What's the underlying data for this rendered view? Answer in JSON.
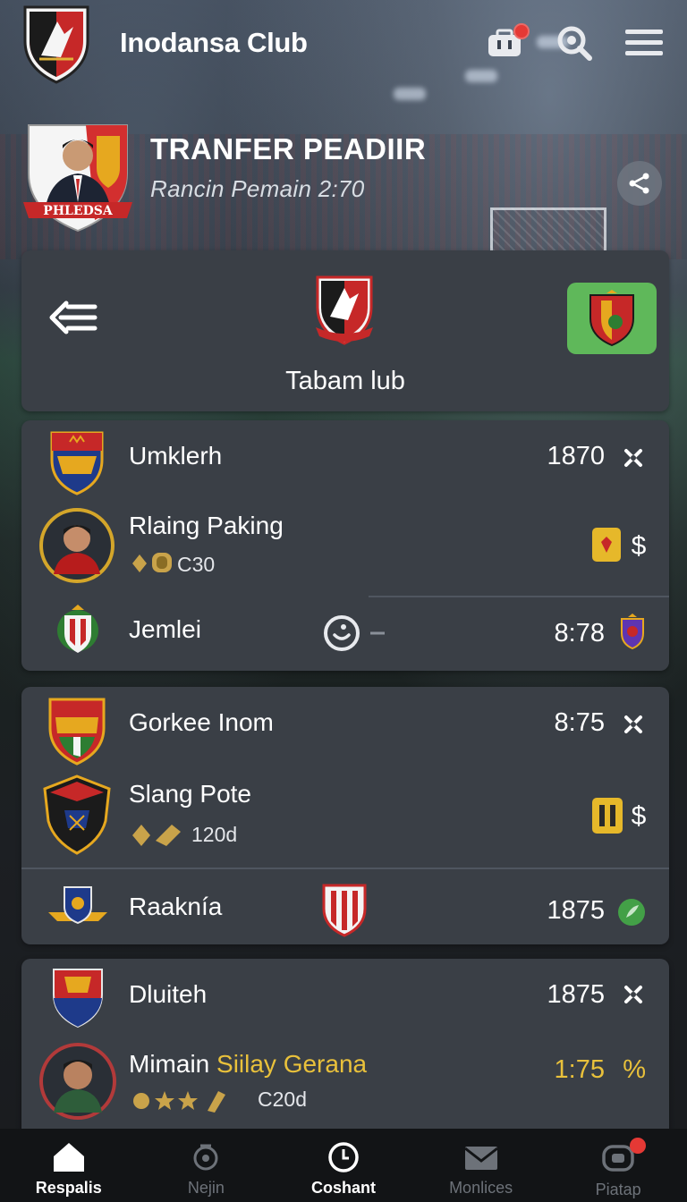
{
  "app": {
    "title": "Inodansa Club",
    "accent": "#e53935"
  },
  "banner": {
    "title": "TRANFER PEADIIR",
    "subtitle": "Rancin  Pemain  2:70",
    "crest_ribbon": "PHLEDSA"
  },
  "club_card": {
    "name": "Tabam lub"
  },
  "groups": [
    {
      "rows": [
        {
          "name": "Umklerh",
          "value": "1870",
          "trail_icon": "close-x-icon"
        },
        {
          "name": "Rlaing Paking",
          "sub": "C30",
          "trail_icon": "dollar-icon"
        },
        {
          "name": "Jemlei",
          "value": "8:78",
          "mid_icon": "smile-toggle-icon",
          "trail_icon": "shield-icon"
        }
      ]
    },
    {
      "rows": [
        {
          "name": "Gorkee Inom",
          "value": "8:75",
          "trail_icon": "close-x-icon"
        },
        {
          "name": "Slang Pote",
          "sub": "120d",
          "trail_icon": "dollar-icon"
        },
        {
          "name": "Raaknía",
          "value": "1875",
          "trail_icon": "leaf-icon"
        }
      ]
    },
    {
      "rows": [
        {
          "name": "Dluiteh",
          "value": "1875",
          "trail_icon": "close-x-icon"
        },
        {
          "name": "Mimain ",
          "name_highlight": "Siilay Gerana",
          "sub": "C20d",
          "value": "1:75",
          "trail_text": "%"
        }
      ]
    }
  ],
  "nav": [
    {
      "label": "Respalis",
      "icon": "home-icon",
      "active": true
    },
    {
      "label": "Nejin",
      "icon": "camera-icon",
      "active": false
    },
    {
      "label": "Coshant",
      "icon": "clock-icon",
      "active": true
    },
    {
      "label": "Monlices",
      "icon": "mail-icon",
      "active": false
    },
    {
      "label": "Piatap",
      "icon": "chat-icon",
      "active": false
    }
  ]
}
